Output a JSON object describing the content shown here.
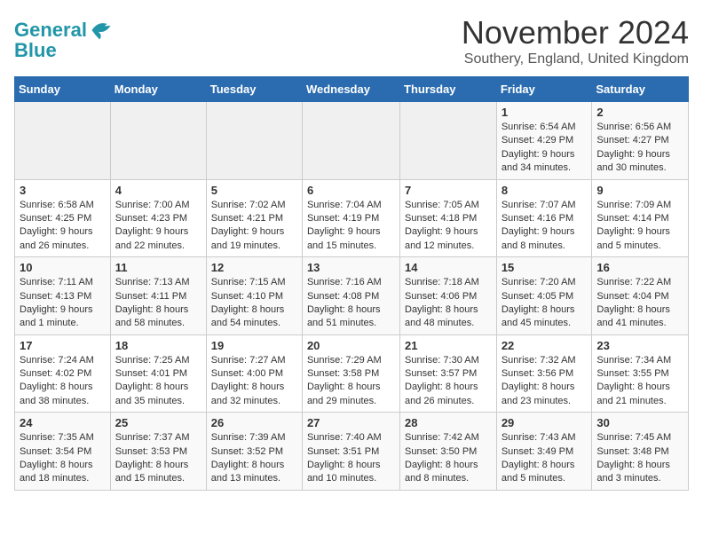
{
  "header": {
    "logo_line1": "General",
    "logo_line2": "Blue",
    "month": "November 2024",
    "location": "Southery, England, United Kingdom"
  },
  "days_of_week": [
    "Sunday",
    "Monday",
    "Tuesday",
    "Wednesday",
    "Thursday",
    "Friday",
    "Saturday"
  ],
  "weeks": [
    [
      {
        "day": "",
        "info": ""
      },
      {
        "day": "",
        "info": ""
      },
      {
        "day": "",
        "info": ""
      },
      {
        "day": "",
        "info": ""
      },
      {
        "day": "",
        "info": ""
      },
      {
        "day": "1",
        "info": "Sunrise: 6:54 AM\nSunset: 4:29 PM\nDaylight: 9 hours and 34 minutes."
      },
      {
        "day": "2",
        "info": "Sunrise: 6:56 AM\nSunset: 4:27 PM\nDaylight: 9 hours and 30 minutes."
      }
    ],
    [
      {
        "day": "3",
        "info": "Sunrise: 6:58 AM\nSunset: 4:25 PM\nDaylight: 9 hours and 26 minutes."
      },
      {
        "day": "4",
        "info": "Sunrise: 7:00 AM\nSunset: 4:23 PM\nDaylight: 9 hours and 22 minutes."
      },
      {
        "day": "5",
        "info": "Sunrise: 7:02 AM\nSunset: 4:21 PM\nDaylight: 9 hours and 19 minutes."
      },
      {
        "day": "6",
        "info": "Sunrise: 7:04 AM\nSunset: 4:19 PM\nDaylight: 9 hours and 15 minutes."
      },
      {
        "day": "7",
        "info": "Sunrise: 7:05 AM\nSunset: 4:18 PM\nDaylight: 9 hours and 12 minutes."
      },
      {
        "day": "8",
        "info": "Sunrise: 7:07 AM\nSunset: 4:16 PM\nDaylight: 9 hours and 8 minutes."
      },
      {
        "day": "9",
        "info": "Sunrise: 7:09 AM\nSunset: 4:14 PM\nDaylight: 9 hours and 5 minutes."
      }
    ],
    [
      {
        "day": "10",
        "info": "Sunrise: 7:11 AM\nSunset: 4:13 PM\nDaylight: 9 hours and 1 minute."
      },
      {
        "day": "11",
        "info": "Sunrise: 7:13 AM\nSunset: 4:11 PM\nDaylight: 8 hours and 58 minutes."
      },
      {
        "day": "12",
        "info": "Sunrise: 7:15 AM\nSunset: 4:10 PM\nDaylight: 8 hours and 54 minutes."
      },
      {
        "day": "13",
        "info": "Sunrise: 7:16 AM\nSunset: 4:08 PM\nDaylight: 8 hours and 51 minutes."
      },
      {
        "day": "14",
        "info": "Sunrise: 7:18 AM\nSunset: 4:06 PM\nDaylight: 8 hours and 48 minutes."
      },
      {
        "day": "15",
        "info": "Sunrise: 7:20 AM\nSunset: 4:05 PM\nDaylight: 8 hours and 45 minutes."
      },
      {
        "day": "16",
        "info": "Sunrise: 7:22 AM\nSunset: 4:04 PM\nDaylight: 8 hours and 41 minutes."
      }
    ],
    [
      {
        "day": "17",
        "info": "Sunrise: 7:24 AM\nSunset: 4:02 PM\nDaylight: 8 hours and 38 minutes."
      },
      {
        "day": "18",
        "info": "Sunrise: 7:25 AM\nSunset: 4:01 PM\nDaylight: 8 hours and 35 minutes."
      },
      {
        "day": "19",
        "info": "Sunrise: 7:27 AM\nSunset: 4:00 PM\nDaylight: 8 hours and 32 minutes."
      },
      {
        "day": "20",
        "info": "Sunrise: 7:29 AM\nSunset: 3:58 PM\nDaylight: 8 hours and 29 minutes."
      },
      {
        "day": "21",
        "info": "Sunrise: 7:30 AM\nSunset: 3:57 PM\nDaylight: 8 hours and 26 minutes."
      },
      {
        "day": "22",
        "info": "Sunrise: 7:32 AM\nSunset: 3:56 PM\nDaylight: 8 hours and 23 minutes."
      },
      {
        "day": "23",
        "info": "Sunrise: 7:34 AM\nSunset: 3:55 PM\nDaylight: 8 hours and 21 minutes."
      }
    ],
    [
      {
        "day": "24",
        "info": "Sunrise: 7:35 AM\nSunset: 3:54 PM\nDaylight: 8 hours and 18 minutes."
      },
      {
        "day": "25",
        "info": "Sunrise: 7:37 AM\nSunset: 3:53 PM\nDaylight: 8 hours and 15 minutes."
      },
      {
        "day": "26",
        "info": "Sunrise: 7:39 AM\nSunset: 3:52 PM\nDaylight: 8 hours and 13 minutes."
      },
      {
        "day": "27",
        "info": "Sunrise: 7:40 AM\nSunset: 3:51 PM\nDaylight: 8 hours and 10 minutes."
      },
      {
        "day": "28",
        "info": "Sunrise: 7:42 AM\nSunset: 3:50 PM\nDaylight: 8 hours and 8 minutes."
      },
      {
        "day": "29",
        "info": "Sunrise: 7:43 AM\nSunset: 3:49 PM\nDaylight: 8 hours and 5 minutes."
      },
      {
        "day": "30",
        "info": "Sunrise: 7:45 AM\nSunset: 3:48 PM\nDaylight: 8 hours and 3 minutes."
      }
    ]
  ]
}
